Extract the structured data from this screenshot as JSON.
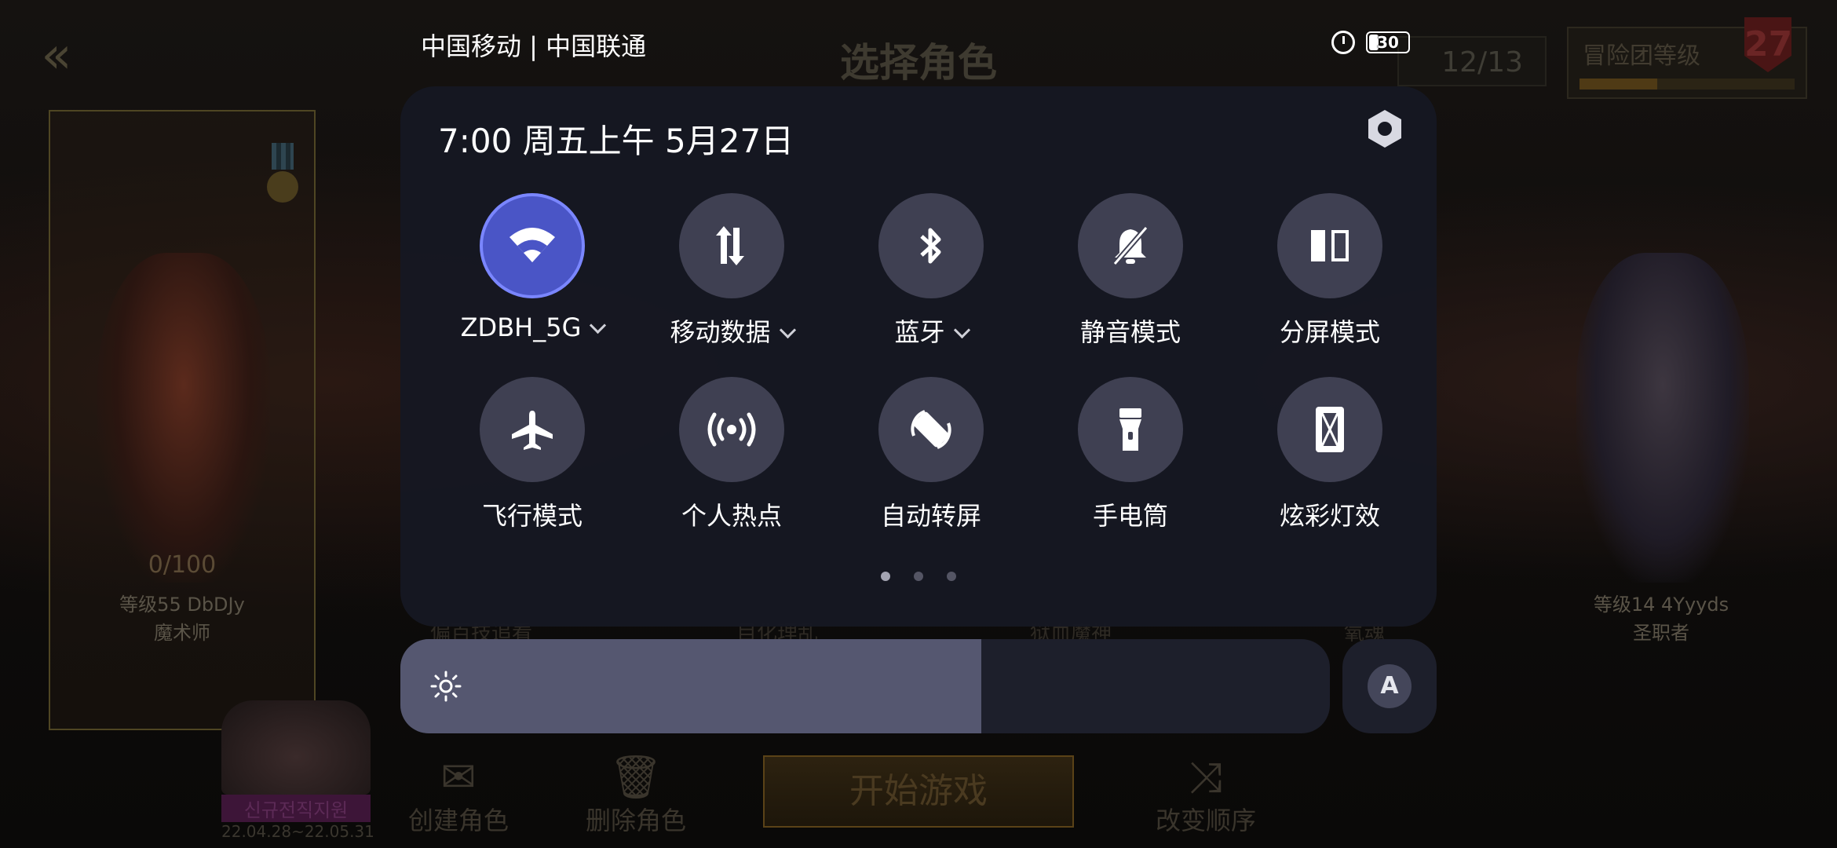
{
  "status_bar": {
    "carrier": "中国移动 | 中国联通",
    "battery": "30",
    "alarm_icon": "alarm-icon"
  },
  "game": {
    "title": "选择角色",
    "character_count": "12/13",
    "rank_label": "冒险团等级",
    "rank_level": "27",
    "rank_progress": 0.36,
    "characters": [
      {
        "progress": "0/100",
        "level": "等级55 DbDJy",
        "class": "魔术师"
      },
      {
        "level": "等级14 4Yyyds",
        "class": "圣职者"
      }
    ],
    "hidden_names": [
      "偏百技追看",
      "目化理乱",
      "狱血魔神",
      "氧魂"
    ],
    "event": {
      "tag": "신규전직지원",
      "dates": "22.04.28~22.05.31"
    },
    "create_label": "创建角色",
    "delete_label": "删除角色",
    "start_label": "开始游戏",
    "reorder_label": "改变顺序"
  },
  "control_center": {
    "datetime": "7:00 周五上午 5月27日",
    "tiles": [
      {
        "label": "ZDBH_5G",
        "icon": "wifi-icon",
        "active": true,
        "dropdown": true
      },
      {
        "label": "移动数据",
        "icon": "mobile-data-icon",
        "active": false,
        "dropdown": true
      },
      {
        "label": "蓝牙",
        "icon": "bluetooth-icon",
        "active": false,
        "dropdown": true
      },
      {
        "label": "静音模式",
        "icon": "silent-mode-icon",
        "active": false
      },
      {
        "label": "分屏模式",
        "icon": "split-screen-icon",
        "active": false
      },
      {
        "label": "飞行模式",
        "icon": "airplane-icon",
        "active": false
      },
      {
        "label": "个人热点",
        "icon": "hotspot-icon",
        "active": false
      },
      {
        "label": "自动转屏",
        "icon": "auto-rotate-icon",
        "active": false
      },
      {
        "label": "手电筒",
        "icon": "flashlight-icon",
        "active": false
      },
      {
        "label": "炫彩灯效",
        "icon": "light-effect-icon",
        "active": false
      }
    ],
    "page_indicator": {
      "count": 3,
      "current": 1
    },
    "brightness": 0.625,
    "auto_brightness_label": "A",
    "accent_color": "#4a55c6"
  }
}
